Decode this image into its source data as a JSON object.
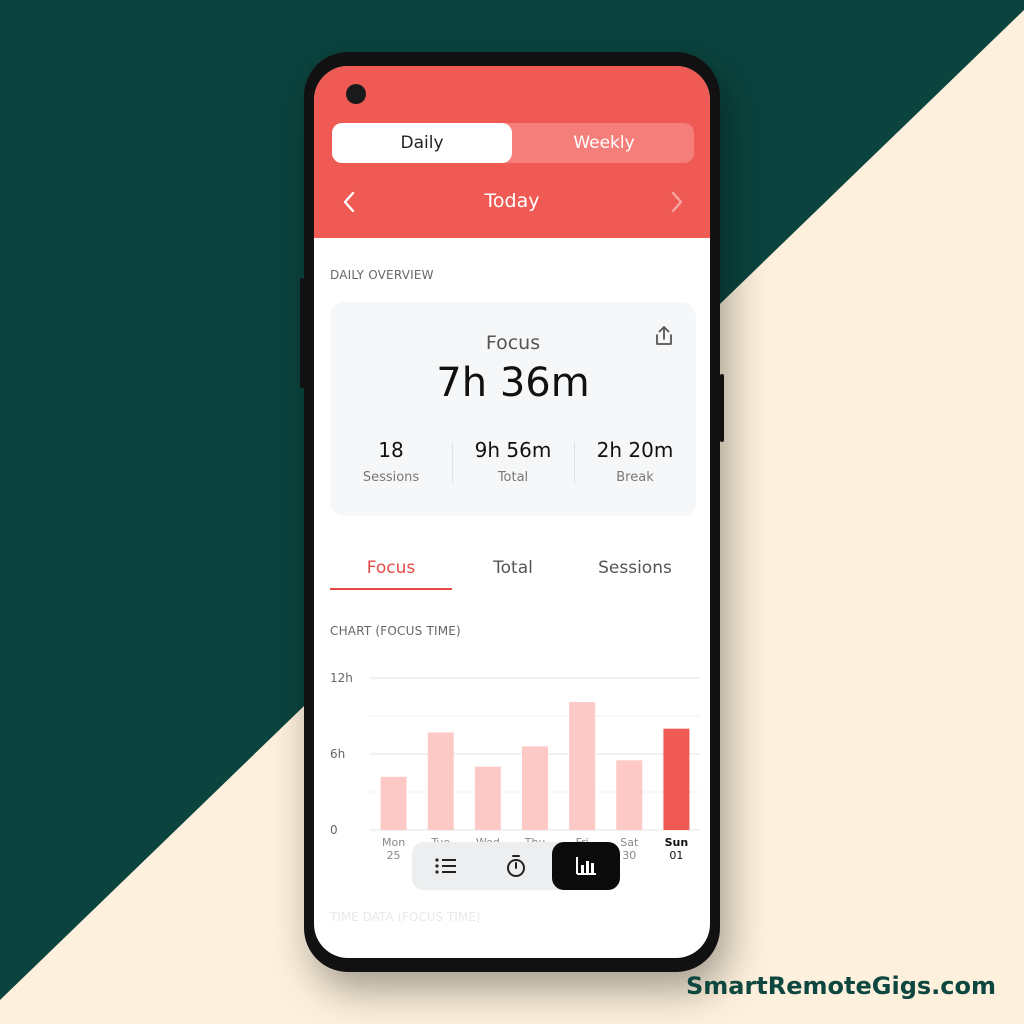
{
  "colors": {
    "bg_dark": "#0b433e",
    "bg_light": "#fdf0dc",
    "accent": "#f05a55",
    "bar_light": "#fdc9c7",
    "bar_active": "#f05a55"
  },
  "header": {
    "segments": {
      "daily": "Daily",
      "weekly": "Weekly",
      "selected": "Daily"
    },
    "period_label": "Today",
    "prev_icon": "chevron-left-icon",
    "next_icon": "chevron-right-icon"
  },
  "overview": {
    "section_label": "DAILY OVERVIEW",
    "focus_label": "Focus",
    "focus_value": "7h 36m",
    "share_icon": "share-icon",
    "stats": [
      {
        "value": "18",
        "label": "Sessions"
      },
      {
        "value": "9h 56m",
        "label": "Total"
      },
      {
        "value": "2h 20m",
        "label": "Break"
      }
    ]
  },
  "tabs": {
    "items": [
      "Focus",
      "Total",
      "Sessions"
    ],
    "active": "Focus"
  },
  "chart_section_label": "CHART (FOCUS TIME)",
  "chart_data": {
    "type": "bar",
    "title": "",
    "xlabel": "",
    "ylabel": "",
    "y_ticks": [
      "12h",
      "6h",
      "0"
    ],
    "ylim": [
      0,
      12
    ],
    "categories": [
      {
        "day": "Mon",
        "date": "25"
      },
      {
        "day": "Tue",
        "date": "26"
      },
      {
        "day": "Wed",
        "date": "27"
      },
      {
        "day": "Thu",
        "date": "28"
      },
      {
        "day": "Fri",
        "date": "29"
      },
      {
        "day": "Sat",
        "date": "30"
      },
      {
        "day": "Sun",
        "date": "01"
      }
    ],
    "values": [
      4.2,
      7.7,
      5.0,
      6.6,
      10.1,
      5.5,
      8.0
    ],
    "highlighted": "Sun",
    "grid": true
  },
  "bottom_section_label": "TIME DATA (FOCUS TIME)",
  "toolbar": {
    "items": [
      {
        "icon": "list-icon"
      },
      {
        "icon": "timer-icon"
      },
      {
        "icon": "bar-chart-icon",
        "active": true
      }
    ]
  },
  "watermark": "SmartRemoteGigs.com"
}
